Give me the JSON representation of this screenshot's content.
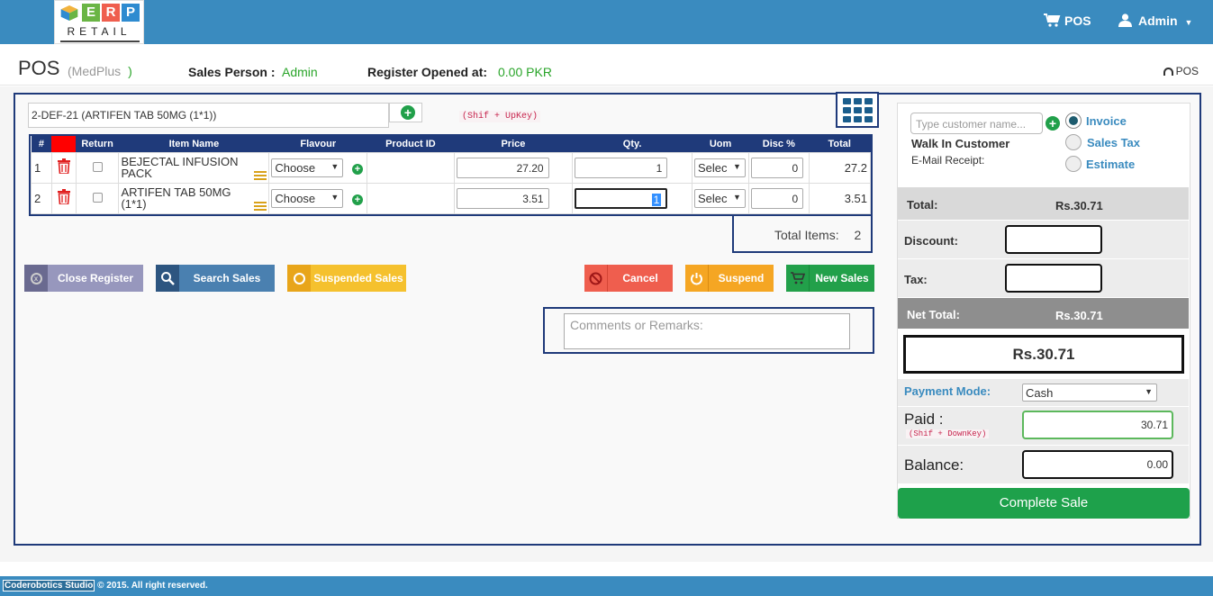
{
  "header": {
    "logo_letters": [
      "E",
      "R",
      "P"
    ],
    "logo_sub": "RETAIL",
    "nav_pos": "POS",
    "nav_user": "Admin"
  },
  "page": {
    "title": "POS",
    "subtitle": "(MedPlus",
    "subtitle_close": ")",
    "sales_person_label": "Sales Person :",
    "sales_person_value": "Admin",
    "register_label": "Register Opened at:",
    "register_value": "0.00 PKR",
    "breadcrumb": "POS"
  },
  "search": {
    "value": "2-DEF-21 (ARTIFEN TAB 50MG (1*1))",
    "hint": "(Shif + UpKey)"
  },
  "table": {
    "columns": [
      "#",
      "",
      "Return",
      "Item Name",
      "Flavour",
      "Product ID",
      "Price",
      "Qty.",
      "Uom",
      "Disc %",
      "Total"
    ],
    "rows": [
      {
        "num": "1",
        "name": "BEJECTAL INFUSION PACK",
        "flavour": "Choose",
        "product_id": "",
        "price": "27.20",
        "qty": "1",
        "uom": "Selec",
        "disc": "0",
        "total": "27.2"
      },
      {
        "num": "2",
        "name": "ARTIFEN TAB 50MG (1*1)",
        "flavour": "Choose",
        "product_id": "",
        "price": "3.51",
        "qty": "1",
        "uom": "Selec",
        "disc": "0",
        "total": "3.51"
      }
    ],
    "total_items_label": "Total Items:",
    "total_items_value": "2"
  },
  "actions": {
    "close_register": "Close Register",
    "search_sales": "Search Sales",
    "suspended_sales": "Suspended Sales",
    "cancel": "Cancel",
    "suspend": "Suspend",
    "new_sales": "New Sales"
  },
  "comments": {
    "placeholder": "Comments or Remarks:"
  },
  "customer": {
    "placeholder": "Type customer name...",
    "name": "Walk In Customer",
    "email_label": "E-Mail Receipt:",
    "doc_types": [
      {
        "label": "Invoice",
        "selected": true
      },
      {
        "label": "Sales Tax",
        "selected": false
      },
      {
        "label": "Estimate",
        "selected": false
      }
    ]
  },
  "summary": {
    "total_label": "Total:",
    "total_value": "Rs.30.71",
    "discount_label": "Discount:",
    "discount_value": "",
    "tax_label": "Tax:",
    "tax_value": "",
    "net_total_label": "Net Total:",
    "net_total_value": "Rs.30.71",
    "grand_value": "Rs.30.71",
    "payment_mode_label": "Payment Mode:",
    "payment_mode_value": "Cash",
    "paid_label": "Paid :",
    "paid_hint": "(Shif + DownKey)",
    "paid_value": "30.71",
    "balance_label": "Balance:",
    "balance_value": "0.00",
    "complete_label": "Complete Sale"
  },
  "footer": {
    "company": "Coderobotics Studio",
    "copyright": "© 2015. All right reserved."
  },
  "colors": {
    "header": "#3a8bbf",
    "navy": "#1f3a7a",
    "green": "#1ea14b",
    "cancel": "#ef5e4e",
    "suspend": "#f5a623",
    "close_register": "#9b9bbc",
    "search_sales": "#4a7fb0"
  }
}
